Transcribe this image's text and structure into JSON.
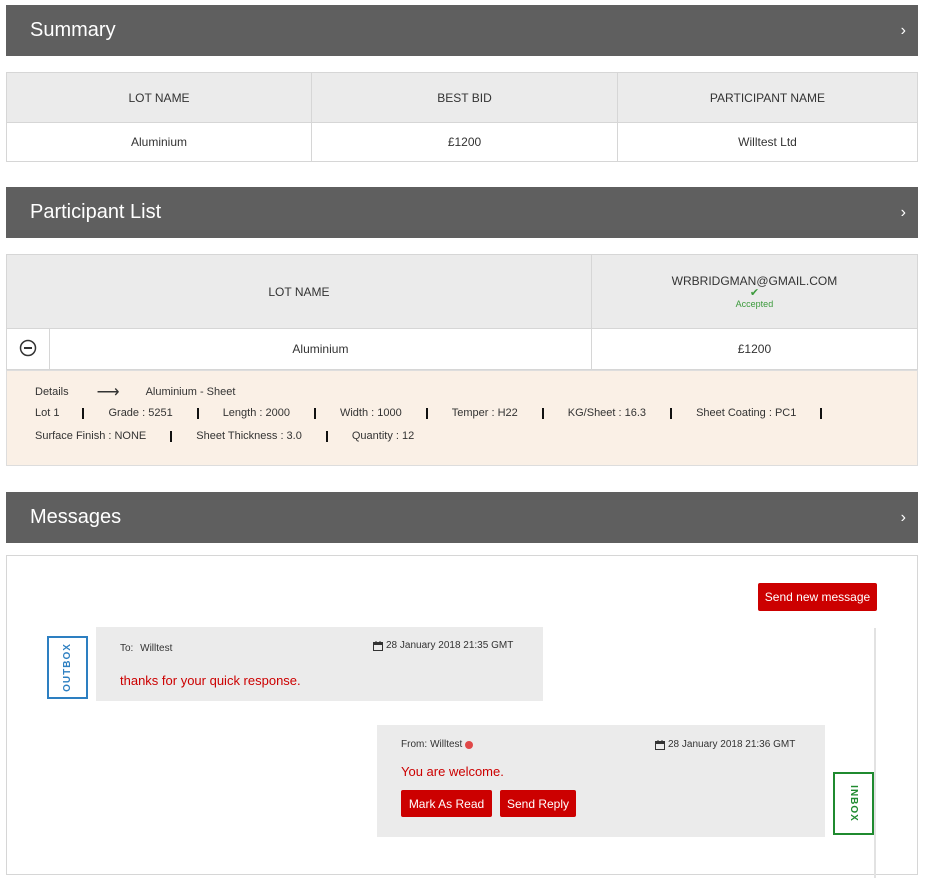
{
  "summary": {
    "title": "Summary",
    "chevron": "›",
    "columns": [
      "LOT NAME",
      "BEST BID",
      "PARTICIPANT NAME"
    ],
    "row": [
      "Aluminium",
      "£1200",
      "Willtest Ltd"
    ]
  },
  "participants": {
    "title": "Participant List",
    "chevron": "›",
    "lot_header": "LOT NAME",
    "participant_email": "WRBRIDGMAN@GMAIL.COM",
    "participant_status": "Accepted",
    "check_glyph": "✔",
    "row": {
      "lot": "Aluminium",
      "bid": "£1200"
    },
    "details": {
      "label": "Details",
      "arrow": "⟶",
      "product": "Aluminium - Sheet",
      "line1": [
        "Lot 1",
        "Grade : 5251",
        "Length : 2000",
        "Width : 1000",
        "Temper : H22",
        "KG/Sheet : 16.3",
        "Sheet Coating : PC1"
      ],
      "line2": [
        "Surface Finish : NONE",
        "Sheet Thickness : 3.0",
        "Quantity : 12"
      ]
    }
  },
  "messages": {
    "title": "Messages",
    "chevron": "›",
    "send_new_label": "Send new message",
    "outbox": {
      "tag": "OUTBOX",
      "to_label": "To:",
      "to_name": "Willtest",
      "date": "28 January 2018 21:35 GMT",
      "body": "thanks for your quick response."
    },
    "inbox": {
      "tag": "INBOX",
      "from_label": "From:",
      "from_name": "Willtest",
      "date": "28 January 2018 21:36 GMT",
      "body": "You are welcome.",
      "mark_read_label": "Mark As Read",
      "reply_label": "Send Reply"
    }
  },
  "colors": {
    "header_bg": "#5f5f5f",
    "accent_red": "#cc0000",
    "accepted_green": "#3c9a3c",
    "outbox_blue": "#2d7fc1",
    "inbox_green": "#1f8a2f",
    "details_bg": "#faf0e6"
  }
}
